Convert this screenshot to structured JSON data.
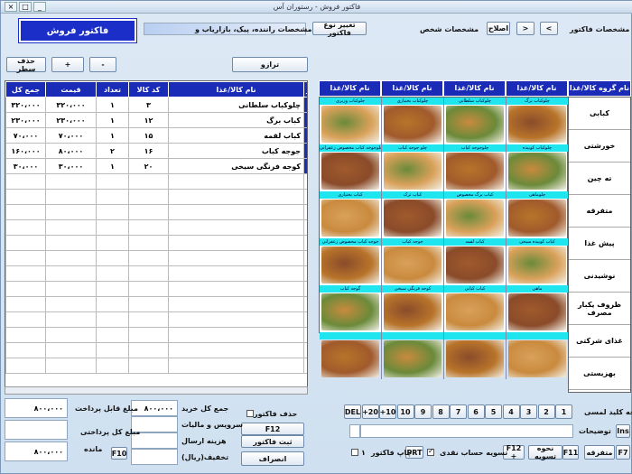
{
  "window": {
    "title": "فاکتور فروش - رستوران آس"
  },
  "header": {
    "banner": "فاکتور فروش",
    "invoice_spec_label": "مشخصات فاکتور",
    "prev": "<",
    "next": ">",
    "edit": "اصلاح",
    "person_spec": "مشخصات شخص",
    "change_type": "تغییر نوع فاکتور",
    "driver_spec": "مشخصات راننده، پیک، بازاریاب و ..."
  },
  "toolbar": {
    "delete_row": "حذف سطر",
    "plus": "+",
    "minus": "-",
    "transfer": "ترازو"
  },
  "invoice": {
    "columns": [
      "ر",
      "نام کالا/غذا",
      "کد کالا",
      "تعداد",
      "قیمت",
      "جمع کل"
    ],
    "rows": [
      {
        "idx": "۱",
        "name": "چلوکباب سلطانی",
        "code": "۳",
        "qty": "۱",
        "price": "۳۲۰،۰۰۰",
        "total": "۳۲۰،۰۰۰"
      },
      {
        "idx": "۲",
        "name": "کباب برگ",
        "code": "۱۲",
        "qty": "۱",
        "price": "۲۳۰،۰۰۰",
        "total": "۲۳۰،۰۰۰"
      },
      {
        "idx": "۳",
        "name": "کباب لقمه",
        "code": "۱۵",
        "qty": "۱",
        "price": "۷۰،۰۰۰",
        "total": "۷۰،۰۰۰"
      },
      {
        "idx": "۴",
        "name": "جوجه کباب",
        "code": "۱۶",
        "qty": "۲",
        "price": "۸۰،۰۰۰",
        "total": "۱۶۰،۰۰۰"
      },
      {
        "idx": "۵",
        "name": "کوجه فرنگی سیخی",
        "code": "۲۰",
        "qty": "۱",
        "price": "۳۰،۰۰۰",
        "total": "۳۰،۰۰۰"
      }
    ]
  },
  "foods": {
    "group_header": "نام گروه کالا/غذا",
    "col_headers": [
      "نام کالا/غذا",
      "نام کالا/غذا",
      "نام کالا/غذا",
      "نام کالا/غذا"
    ],
    "rows": [
      [
        "چلوکباب برگ",
        "چلوکباب سلطانی",
        "چلوکباب بختیاری",
        "چلوکباب وزیری"
      ],
      [
        "چلوکباب کوبیده",
        "چلوجوجه کباب",
        "چلو جوجه کباب",
        "چلوجوجه کباب مخصوص زعفرانی"
      ],
      [
        "چلوماهی",
        "کباب برگ مخصوص",
        "کباب ترک",
        "کباب بختیاری"
      ],
      [
        "کباب کوبیده سیخی",
        "کباب لقمه",
        "جوجه کباب",
        "جوجه کباب مخصوص زعفرانی"
      ],
      [
        "ماهی",
        "کباب کبابی",
        "کوجه فرنگی سیخی",
        "گوجه کباب"
      ],
      [
        "",
        "",
        "",
        ""
      ]
    ],
    "colors": [
      "#8a4b2a",
      "#c98a3e",
      "#b8742a",
      "#6a8a3a",
      "#a05a2c",
      "#d9a15a"
    ]
  },
  "categories": [
    "کبابی",
    "خورشتی",
    "ته چین",
    "متفرقه",
    "پیش غذا",
    "نوشیدنی",
    "ظروف یکبار مصرف",
    "غذای شرکتی",
    "بهزیستی"
  ],
  "keypad": {
    "label": "صفحه کلید لمسی",
    "keys": [
      "1",
      "2",
      "3",
      "4",
      "5",
      "6",
      "7",
      "8",
      "9",
      "10",
      "+10",
      "+20",
      "DEL"
    ]
  },
  "footer": {
    "description_label": "توضیحات",
    "ins": "Ins",
    "delete_invoice": "حذف فاکتور",
    "f12": "F12",
    "save_invoice": "ثبت فاکتور",
    "cancel": "انصراف",
    "print_invoice": "چاپ فاکتور",
    "prt": "PRT",
    "settle_account": "تسویه حساب نقدی",
    "settle_f12": "F12 +",
    "settle_method": "نحوه تسویه",
    "f11": "F11",
    "misc": "متفرقه",
    "f7": "F7",
    "settle_count": "۱",
    "total_purchase_label": "جمع کل خرید",
    "total_purchase": "۸۰۰،۰۰۰",
    "service_tax_label": "سرویس و مالیات",
    "shipping_label": "هزینه ارسال",
    "discount_label": "تخفیف(ریال)",
    "payable_label": "مبلغ قابل پرداخت",
    "payable": "۸۰۰،۰۰۰",
    "paid_label": "مبلغ کل پرداختی",
    "remaining_label": "مانده",
    "remaining": "۸۰۰،۰۰۰",
    "f10": "F10"
  }
}
